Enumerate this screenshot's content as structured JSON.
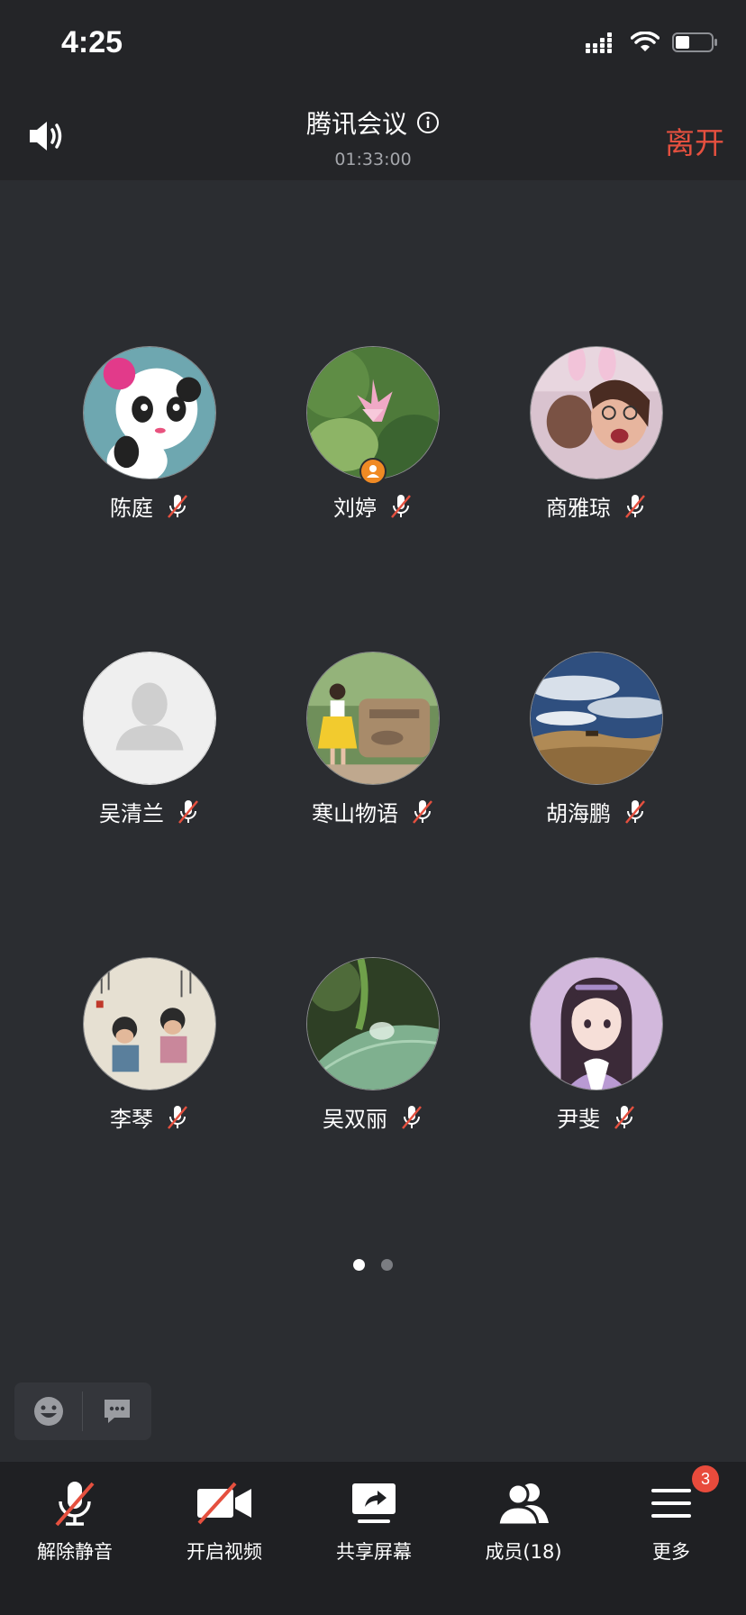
{
  "status_bar": {
    "time": "4:25"
  },
  "header": {
    "title": "腾讯会议",
    "elapsed": "01:33:00",
    "leave_label": "离开"
  },
  "participants": [
    {
      "name": "陈庭",
      "muted": true,
      "avatar": "panda-cartoon"
    },
    {
      "name": "刘婷",
      "muted": true,
      "avatar": "lotus-flower",
      "host": true
    },
    {
      "name": "商雅琼",
      "muted": true,
      "avatar": "selfie-bunny-ears"
    },
    {
      "name": "吴清兰",
      "muted": true,
      "avatar": "default-person"
    },
    {
      "name": "寒山物语",
      "muted": true,
      "avatar": "woman-yellow-skirt"
    },
    {
      "name": "胡海鹏",
      "muted": true,
      "avatar": "desert-sky"
    },
    {
      "name": "李琴",
      "muted": true,
      "avatar": "ink-painting-children"
    },
    {
      "name": "吴双丽",
      "muted": true,
      "avatar": "water-drop-leaf"
    },
    {
      "name": "尹斐",
      "muted": true,
      "avatar": "anime-girl"
    }
  ],
  "pagination": {
    "pages": 2,
    "current": 1
  },
  "toolbar": {
    "unmute_label": "解除静音",
    "video_label": "开启视频",
    "share_label": "共享屏幕",
    "members_label": "成员(18)",
    "more_label": "更多",
    "more_badge": "3"
  },
  "colors": {
    "background": "#2b2d31",
    "header": "#242528",
    "toolbar": "#1f2023",
    "leave": "#e5503f",
    "badge": "#e84b3c",
    "host_badge": "#f08a24"
  }
}
